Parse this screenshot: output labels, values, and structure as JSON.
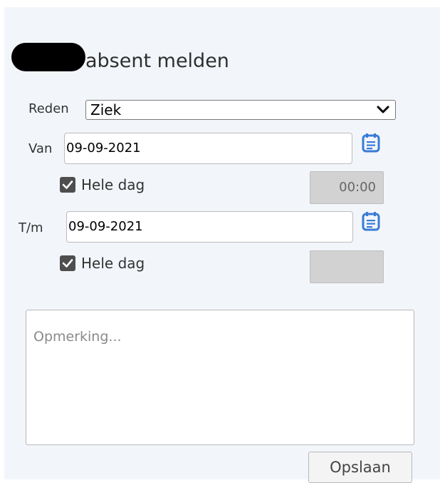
{
  "form": {
    "title": "absent melden",
    "reason_label": "Reden",
    "reason_value": "Ziek",
    "from_label": "Van",
    "from_date": "09-09-2021",
    "from_whole_day_label": "Hele dag",
    "from_whole_day_checked": true,
    "from_time": "00:00",
    "to_label": "T/m",
    "to_date": "09-09-2021",
    "to_whole_day_label": "Hele dag",
    "to_whole_day_checked": true,
    "to_time": "",
    "remark_placeholder": "Opmerking...",
    "save_label": "Opslaan"
  },
  "icons": {
    "calendar": "calendar-icon",
    "chevron": "chevron-down-icon",
    "check": "check-icon"
  },
  "colors": {
    "panel_bg": "#f2f6fb",
    "calendar_accent": "#3a7bd5",
    "disabled_field": "#d2d2d2"
  }
}
